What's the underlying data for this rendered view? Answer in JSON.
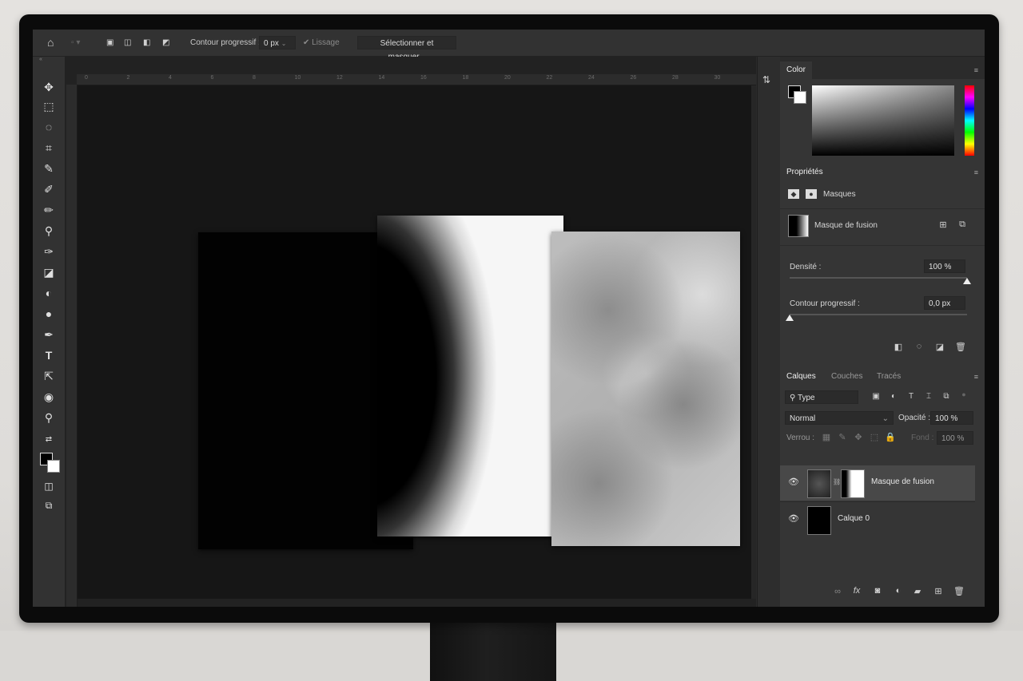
{
  "options_bar": {
    "home_icon": "home-icon",
    "feather_label": "Contour progressif :",
    "feather_value": "0 px",
    "smoothing_label": "Lissage",
    "select_mask_button": "Sélectionner et masquer..."
  },
  "ruler": {
    "ticks": [
      "0",
      "2",
      "4",
      "6",
      "8",
      "10",
      "12",
      "14",
      "16",
      "18",
      "20",
      "22",
      "24",
      "26",
      "28",
      "30"
    ]
  },
  "tools": [
    "move-tool",
    "marquee-tool",
    "lasso-tool",
    "crop-tool",
    "eyedropper-tool",
    "healing-brush-tool",
    "brush-tool",
    "clone-stamp-tool",
    "history-brush-tool",
    "eraser-tool",
    "gradient-tool",
    "blur-tool",
    "dodge-tool",
    "pen-tool",
    "type-tool",
    "path-selection-tool",
    "shape-tool",
    "hand-tool",
    "zoom-tool"
  ],
  "color_panel": {
    "title": "Color",
    "foreground": "#000000",
    "background": "#ffffff"
  },
  "properties_panel": {
    "title": "Propriétés",
    "section": "Masques",
    "mask_name": "Masque de fusion",
    "density_label": "Densité :",
    "density_value": "100 %",
    "density_fraction": 1.0,
    "feather_label": "Contour progressif :",
    "feather_value": "0,0 px",
    "feather_fraction": 0.0
  },
  "layers_panel": {
    "tabs": [
      "Calques",
      "Couches",
      "Tracés"
    ],
    "filter_kind": "Type",
    "blend_mode": "Normal",
    "opacity_label": "Opacité :",
    "opacity_value": "100 %",
    "lock_label": "Verrou :",
    "fill_label": "Fond :",
    "fill_value": "100 %",
    "layers": [
      {
        "name": "Masque de fusion",
        "selected": true
      },
      {
        "name": "Calque 0",
        "selected": false
      }
    ],
    "footer_fx": "fx"
  },
  "colors": {
    "ui_dark": "#2b2b2b",
    "panel": "#353535",
    "text": "#d6d6d6"
  }
}
